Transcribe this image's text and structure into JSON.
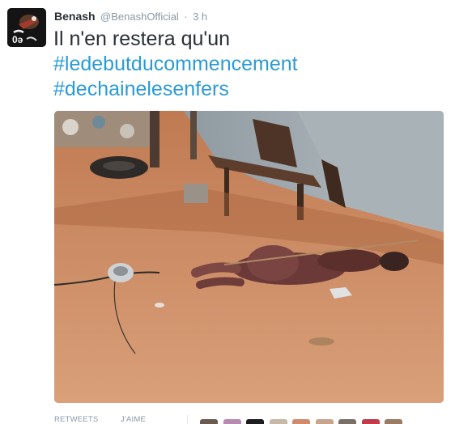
{
  "tweet": {
    "display_name": "Benash",
    "screen_name": "@BenashOfficial",
    "separator": "·",
    "timestamp": "3 h",
    "text_line_1": "Il n'en restera qu'un",
    "hashtag_1": "#ledebutducommencement",
    "hashtag_2": "#dechainelesenfers"
  },
  "stats": {
    "retweets_label": "RETWEETS",
    "likes_label": "J'AIME"
  },
  "colors": {
    "link": "#2b9bd3",
    "meta": "#8899a6",
    "text": "#292f33"
  },
  "likers": [
    {
      "name": "liker-avatar-1",
      "color": "#6b5a4e"
    },
    {
      "name": "liker-avatar-2",
      "color": "#b88ab0"
    },
    {
      "name": "liker-avatar-3",
      "color": "#1d1d1d"
    },
    {
      "name": "liker-avatar-4",
      "color": "#c7b8a8"
    },
    {
      "name": "liker-avatar-5",
      "color": "#d08a6e"
    },
    {
      "name": "liker-avatar-6",
      "color": "#c9a48c"
    },
    {
      "name": "liker-avatar-7",
      "color": "#7a6f66"
    },
    {
      "name": "liker-avatar-8",
      "color": "#c23b4a"
    },
    {
      "name": "liker-avatar-9",
      "color": "#9a7b63"
    }
  ]
}
